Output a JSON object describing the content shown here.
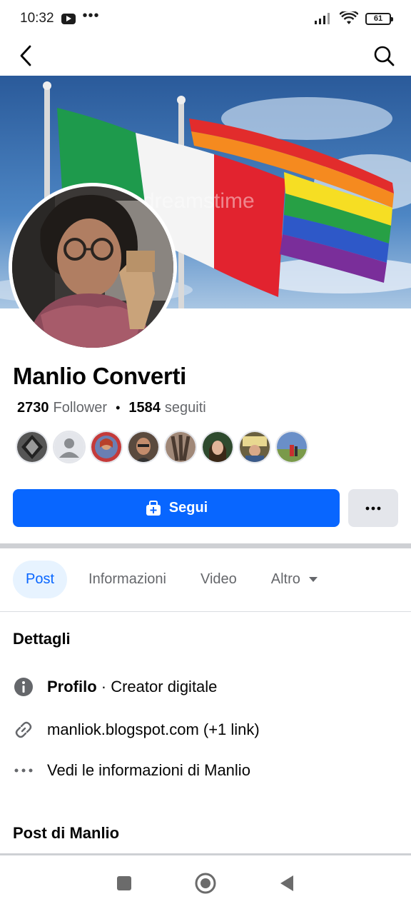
{
  "status": {
    "time": "10:32",
    "dots": "•••",
    "battery": "61"
  },
  "profile": {
    "name": "Manlio Converti",
    "followers_count": "2730",
    "followers_label": "Follower",
    "following_count": "1584",
    "following_label": "seguiti",
    "separator": "•",
    "watermark": "dreamstime"
  },
  "actions": {
    "follow_label": "Segui",
    "more_label": "•••"
  },
  "tabs": [
    {
      "label": "Post",
      "active": true
    },
    {
      "label": "Informazioni",
      "active": false
    },
    {
      "label": "Video",
      "active": false
    },
    {
      "label": "Altro",
      "active": false
    }
  ],
  "details": {
    "title": "Dettagli",
    "profile_bold": "Profilo",
    "profile_rest": " · Creator digitale",
    "link_text": "manliok.blogspot.com (+1 link)",
    "see_info": "Vedi le informazioni di Manlio"
  },
  "posts_title": "Post di Manlio",
  "colors": {
    "accent": "#0866ff",
    "tab_active_bg": "#e7f3ff",
    "secondary_text": "#65676b"
  }
}
